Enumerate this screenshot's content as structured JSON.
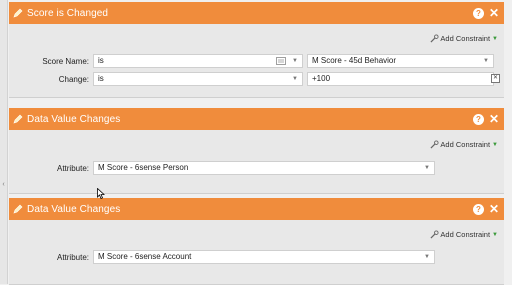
{
  "panels": [
    {
      "title": "Score is Changed",
      "add_constraint": "Add Constraint",
      "rows": [
        {
          "label": "Score Name:",
          "operator": "is",
          "value": "M Score - 45d Behavior"
        },
        {
          "label": "Change:",
          "operator": "is",
          "value": "+100"
        }
      ]
    },
    {
      "title": "Data Value Changes",
      "add_constraint": "Add Constraint",
      "attribute_label": "Attribute:",
      "attribute_value": "M Score - 6sense Person"
    },
    {
      "title": "Data Value Changes",
      "add_constraint": "Add Constraint",
      "attribute_label": "Attribute:",
      "attribute_value": "M Score - 6sense Account"
    }
  ],
  "colors": {
    "header": "#f08c3c",
    "body": "#e8e8e8",
    "accent_arrow": "#3a9a3a"
  },
  "icons": [
    "pencil-icon",
    "help-icon",
    "close-icon",
    "wrench-icon",
    "list-icon",
    "chevron-down-icon",
    "add-row-icon"
  ]
}
